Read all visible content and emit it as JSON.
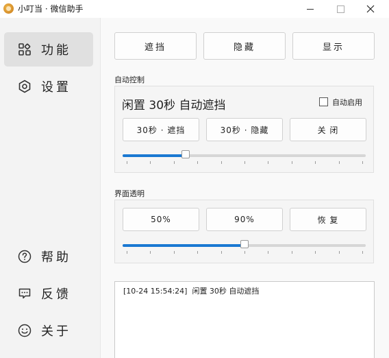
{
  "window": {
    "title": "小叮当 · 微信助手",
    "icon": "app-logo-icon"
  },
  "sidebar": {
    "items": [
      {
        "label": "功能",
        "icon": "grid-icon",
        "active": true
      },
      {
        "label": "设置",
        "icon": "hexagon-settings-icon",
        "active": false
      },
      {
        "label": "帮助",
        "icon": "question-circle-icon",
        "active": false
      },
      {
        "label": "反馈",
        "icon": "chat-bubble-icon",
        "active": false
      },
      {
        "label": "关于",
        "icon": "smiley-icon",
        "active": false
      }
    ]
  },
  "actions": {
    "block": "遮挡",
    "hide": "隐藏",
    "show": "显示"
  },
  "auto_control": {
    "section_label": "自动控制",
    "status_text": "闲置 30秒 自动遮挡",
    "auto_enable_label": "自动启用",
    "auto_enable_checked": false,
    "buttons": {
      "block_30s": "30秒 · 遮挡",
      "hide_30s": "30秒 · 隐藏",
      "close": "关 闭"
    },
    "slider_fraction": 0.26
  },
  "transparency": {
    "section_label": "界面透明",
    "buttons": {
      "p50": "50%",
      "p90": "90%",
      "restore": "恢 复"
    },
    "slider_fraction": 0.5
  },
  "log": {
    "entries": [
      "[10-24 15:54:24]  闲置 30秒 自动遮挡"
    ]
  },
  "colors": {
    "accent": "#1a78d2",
    "sidebar_active": "#e0e0e0"
  }
}
